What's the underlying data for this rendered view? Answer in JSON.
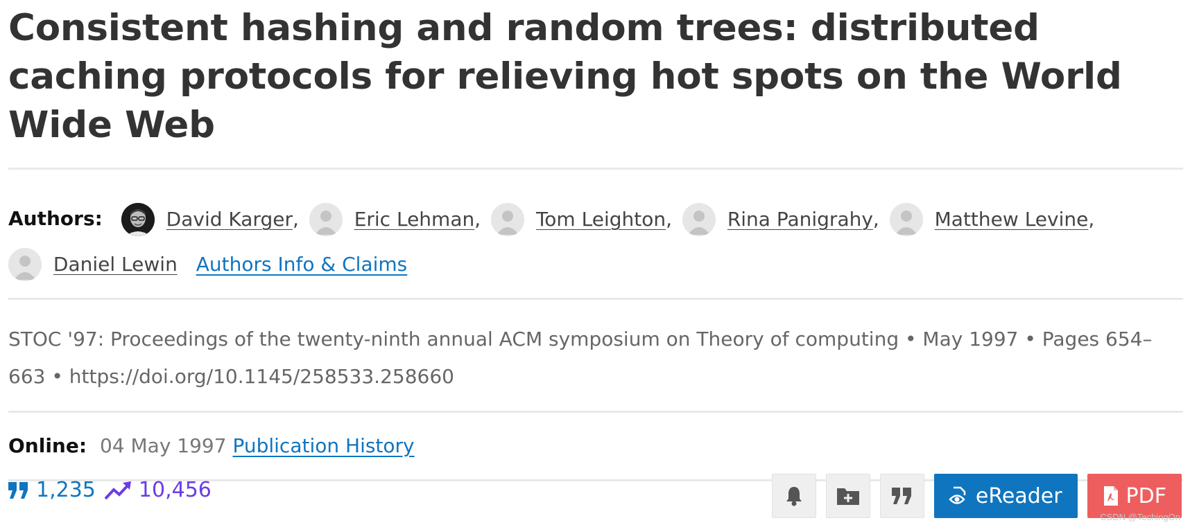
{
  "article": {
    "title": "Consistent hashing and random trees: distributed caching protocols for relieving hot spots on the World Wide Web"
  },
  "authors": {
    "label": "Authors:",
    "list": [
      {
        "name": "David Karger",
        "avatar": "photo"
      },
      {
        "name": "Eric Lehman",
        "avatar": "placeholder"
      },
      {
        "name": "Tom Leighton",
        "avatar": "placeholder"
      },
      {
        "name": "Rina Panigrahy",
        "avatar": "placeholder"
      },
      {
        "name": "Matthew Levine",
        "avatar": "placeholder"
      },
      {
        "name": "Daniel Lewin",
        "avatar": "placeholder"
      }
    ],
    "separator": ",",
    "info_link": "Authors Info & Claims"
  },
  "citation": {
    "text": "STOC '97: Proceedings of the twenty-ninth annual ACM symposium on Theory of computing • May 1997  • Pages 654–663 • https://doi.org/10.1145/258533.258660"
  },
  "online": {
    "label": "Online:",
    "date": "04 May 1997",
    "history_link": "Publication History"
  },
  "metrics": {
    "citations": "1,235",
    "downloads": "10,456"
  },
  "actions": {
    "ereader_label": "eReader",
    "pdf_label": "PDF",
    "icons": [
      "bell-icon",
      "folder-plus-icon",
      "quote-icon",
      "eye-icon",
      "pdf-icon"
    ]
  },
  "watermark": "CSDN @TechingOn",
  "colors": {
    "link": "#0f75bf",
    "metric_views": "#6a3ce5",
    "ereader_bg": "#0f75bf",
    "pdf_bg": "#ee5e5e",
    "title": "#333333"
  }
}
